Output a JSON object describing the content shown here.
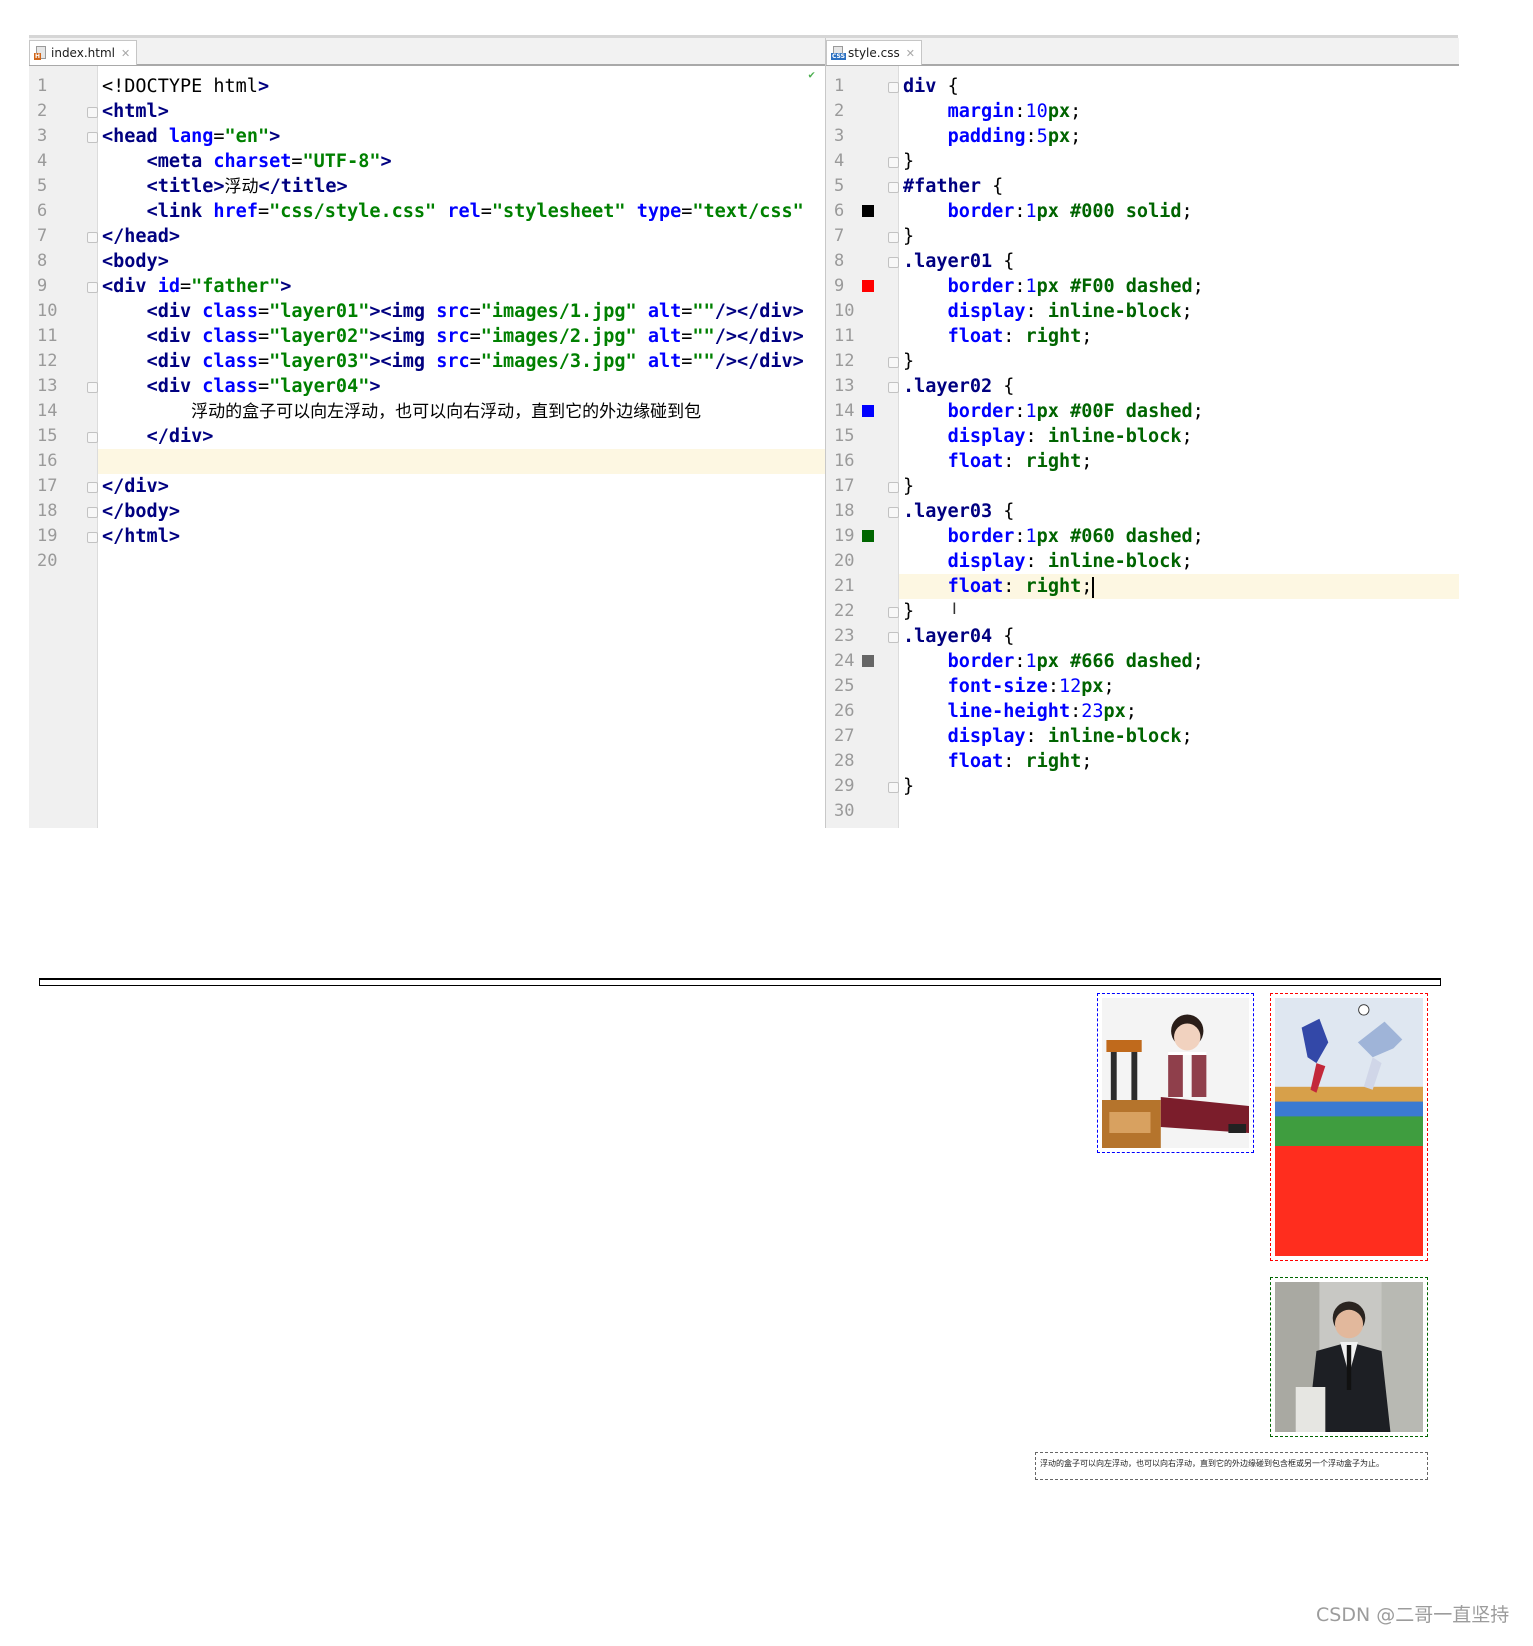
{
  "left_tab": {
    "label": "index.html",
    "icon": "html-file-icon"
  },
  "right_tab": {
    "label": "style.css",
    "icon": "css-file-icon"
  },
  "html_lines": [
    "<!DOCTYPE html>",
    "<html>",
    "<head lang=\"en\">",
    "    <meta charset=\"UTF-8\">",
    "    <title>浮动</title>",
    "    <link href=\"css/style.css\" rel=\"stylesheet\" type=\"text/css\"",
    "</head>",
    "<body>",
    "<div id=\"father\">",
    "    <div class=\"layer01\"><img src=\"images/1.jpg\" alt=\"\"/></div>",
    "    <div class=\"layer02\"><img src=\"images/2.jpg\" alt=\"\"/></div>",
    "    <div class=\"layer03\"><img src=\"images/3.jpg\" alt=\"\"/></div>",
    "    <div class=\"layer04\">",
    "        浮动的盒子可以向左浮动，也可以向右浮动，直到它的外边缘碰到包",
    "    </div>",
    "",
    "</div>",
    "</body>",
    "</html>",
    ""
  ],
  "css_lines": [
    "div {",
    "    margin:10px;",
    "    padding:5px;",
    "}",
    "#father {",
    "    border:1px #000 solid;",
    "}",
    ".layer01 {",
    "    border:1px #F00 dashed;",
    "    display: inline-block;",
    "    float: right;",
    "}",
    ".layer02 {",
    "    border:1px #00F dashed;",
    "    display: inline-block;",
    "    float: right;",
    "}",
    ".layer03 {",
    "    border:1px #060 dashed;",
    "    display: inline-block;",
    "    float: right;",
    "}",
    ".layer04 {",
    "    border:1px #666 dashed;",
    "    font-size:12px;",
    "    line-height:23px;",
    "    display: inline-block;",
    "    float: right;",
    "}",
    ""
  ],
  "left_current_line": 16,
  "right_current_line": 21,
  "color_swatches": [
    {
      "line": 6,
      "color": "#000000"
    },
    {
      "line": 9,
      "color": "#ff0000"
    },
    {
      "line": 14,
      "color": "#0000ff"
    },
    {
      "line": 19,
      "color": "#006600"
    },
    {
      "line": 24,
      "color": "#666666"
    }
  ],
  "preview": {
    "layer04_text": "浮动的盒子可以向左浮动，也可以向右浮动，直到它的外边缘碰到包含框或另一个浮动盒子为止。",
    "images": [
      "portrait-photo",
      "soccer-photo",
      "businessman-photo"
    ]
  },
  "watermark": "CSDN @二哥一直坚持"
}
